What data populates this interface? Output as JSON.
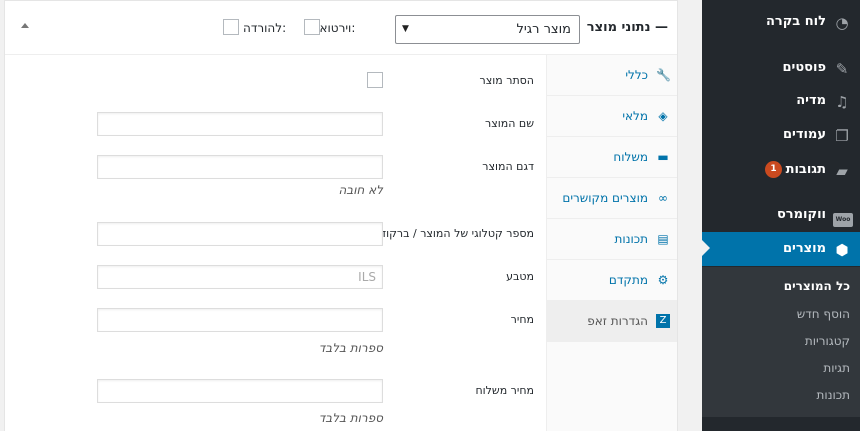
{
  "product_data": {
    "title": "נתוני מוצר —",
    "type_select": {
      "value": "מוצר רגיל"
    },
    "virtual_label": "וירטואלי:",
    "downloadable_label": "להורדה:",
    "tabs": [
      {
        "label": "כללי",
        "icon": "wrench-icon"
      },
      {
        "label": "מלאי",
        "icon": "tag-icon"
      },
      {
        "label": "משלוח",
        "icon": "truck-icon"
      },
      {
        "label": "מוצרים מקושרים",
        "icon": "link-icon"
      },
      {
        "label": "תכונות",
        "icon": "table-icon"
      },
      {
        "label": "מתקדם",
        "icon": "gear-icon"
      },
      {
        "label": "הגדרות זאפ",
        "icon": "zap-icon",
        "active": true
      }
    ],
    "fields": {
      "hide_product": {
        "label": "הסתר מוצר"
      },
      "product_name": {
        "label": "שם המוצר",
        "value": ""
      },
      "product_model": {
        "label": "דגם המוצר",
        "value": "",
        "hint": "לא חובה"
      },
      "catalog_number": {
        "label": "מספר קטלוגי של המוצר / ברקוד",
        "value": ""
      },
      "currency": {
        "label": "מטבע",
        "placeholder": "ILS"
      },
      "price": {
        "label": "מחיר",
        "value": "",
        "hint": "ספרות בלבד"
      },
      "shipping_price": {
        "label": "מחיר משלוח",
        "value": "",
        "hint": "ספרות בלבד"
      }
    }
  },
  "sidebar": {
    "items": [
      {
        "label": "לוח בקרה",
        "icon": "dashboard-icon"
      },
      {
        "label": "פוסטים",
        "icon": "pin-icon"
      },
      {
        "label": "מדיה",
        "icon": "media-icon"
      },
      {
        "label": "עמודים",
        "icon": "pages-icon"
      },
      {
        "label": "תגובות",
        "icon": "comment-icon",
        "badge": "1"
      },
      {
        "label": "ווקומרס",
        "icon": "woo-icon",
        "icon_text": "Woo"
      },
      {
        "label": "מוצרים",
        "icon": "box-icon",
        "active": true
      }
    ],
    "submenu": [
      {
        "label": "כל המוצרים",
        "current": true
      },
      {
        "label": "הוסף חדש"
      },
      {
        "label": "קטגוריות"
      },
      {
        "label": "תגיות"
      },
      {
        "label": "תכונות"
      }
    ]
  },
  "colors": {
    "admin_bar": "#23282d",
    "submenu_bg": "#32373c",
    "accent": "#0073aa",
    "badge": "#ca4a1f"
  }
}
